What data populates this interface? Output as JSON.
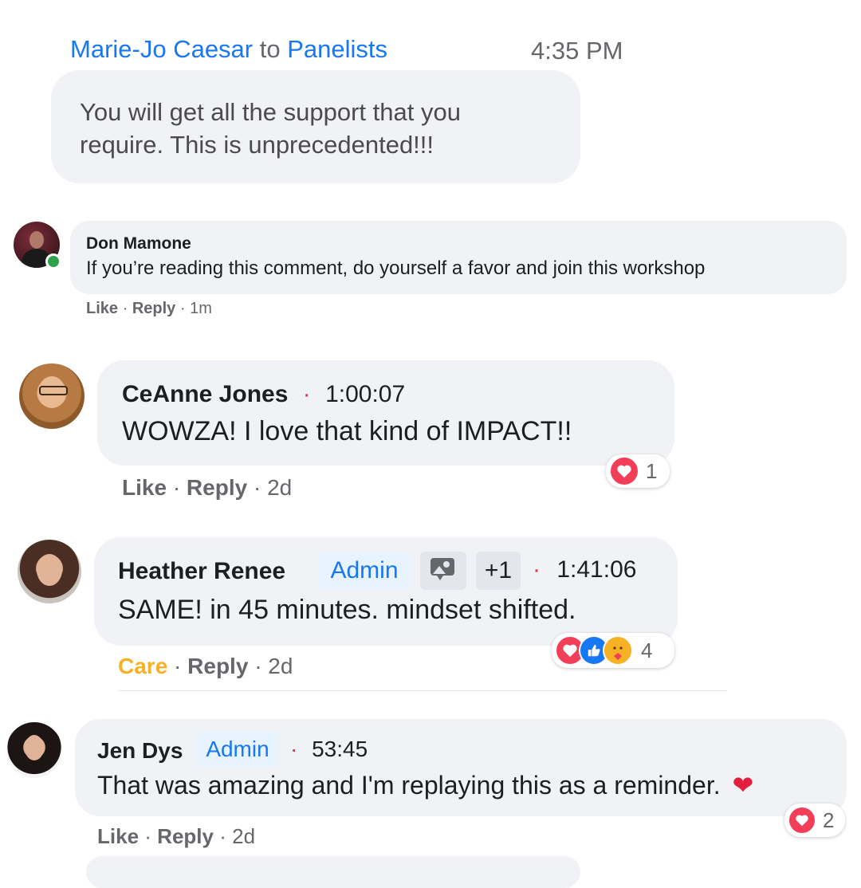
{
  "zoom_message": {
    "sender": "Marie-Jo Caesar",
    "to_word": "to",
    "recipient": "Panelists",
    "time": "4:35 PM",
    "text_line1": "You will get all the support that you",
    "text_line2": "require.  This is unprecedented!!!"
  },
  "comments": [
    {
      "author": "Don Mamone",
      "text": "If you’re reading this comment, do yourself a favor and join this workshop",
      "action1": "Like",
      "action2": "Reply",
      "time": "1m",
      "sep": "·",
      "online": true
    },
    {
      "author": "CeAnne Jones",
      "timestamp": "1:00:07",
      "text": "WOWZA! I love that kind of IMPACT!!",
      "action1": "Like",
      "action2": "Reply",
      "time": "2d",
      "sep": "·",
      "reaction_count": "1"
    },
    {
      "author": "Heather Renee",
      "badge": "Admin",
      "extra_badge": "+1",
      "timestamp": "1:41:06",
      "text": "SAME! in 45 minutes. mindset shifted.",
      "action1": "Care",
      "action2": "Reply",
      "time": "2d",
      "sep": "·",
      "reaction_count": "4"
    },
    {
      "author": "Jen Dys",
      "badge": "Admin",
      "timestamp": "53:45",
      "text": "That was amazing and I'm replaying this as a reminder.",
      "emoji": "❤️",
      "action1": "Like",
      "action2": "Reply",
      "time": "2d",
      "sep": "·",
      "reaction_count": "2"
    }
  ],
  "colors": {
    "link_blue": "#1877f2",
    "bubble_gray": "#f0f2f5",
    "meta_gray": "#65676b",
    "care_orange": "#f7b125",
    "heart_red": "#f33e58"
  }
}
